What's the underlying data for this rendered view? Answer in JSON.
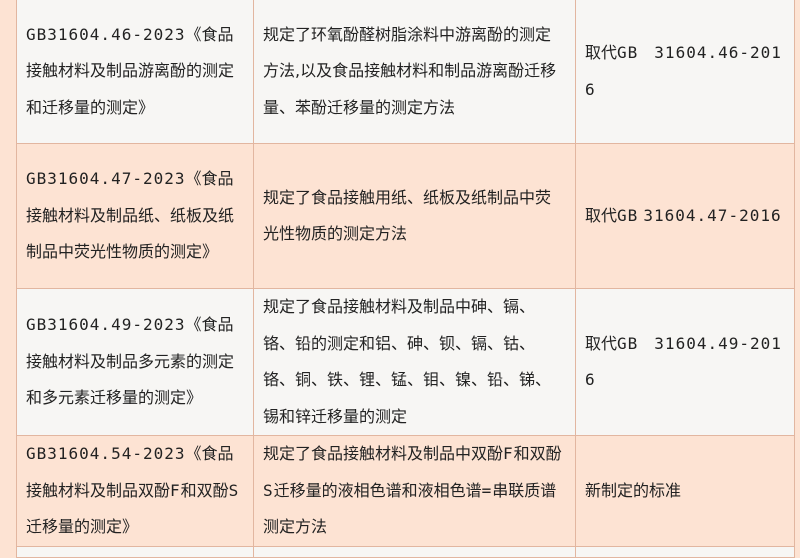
{
  "rows": [
    {
      "standard": "GB31604.46-2023《食品接触材料及制品游离酚的测定和迁移量的测定》",
      "description": "规定了环氧酚醛树脂涂料中游离酚的测定方法,以及食品接触材料和制品游离酚迁移量、苯酚迁移量的测定方法",
      "remark": "取代GB　31604.46-2016"
    },
    {
      "standard": "GB31604.47-2023《食品接触材料及制品纸、纸板及纸制品中荧光性物质的测定》",
      "description": "规定了食品接触用纸、纸板及纸制品中荧光性物质的测定方法",
      "remark": "取代GB 31604.47-2016"
    },
    {
      "standard": "GB31604.49-2023《食品接触材料及制品多元素的测定和多元素迁移量的测定》",
      "description": "规定了食品接触材料及制品中砷、镉、铬、铅的测定和铝、砷、钡、镉、钴、铬、铜、铁、锂、锰、钼、镍、铅、锑、锡和锌迁移量的测定",
      "remark": "取代GB　31604.49-2016"
    },
    {
      "standard": "GB31604.54-2023《食品接触材料及制品双酚F和双酚S迁移量的测定》",
      "description": "规定了食品接触材料及制品中双酚F和双酚S迁移量的液相色谱和液相色谱=串联质谱测定方法",
      "remark": "新制定的标准"
    },
    {
      "standard": "",
      "description": "",
      "remark": ""
    }
  ]
}
